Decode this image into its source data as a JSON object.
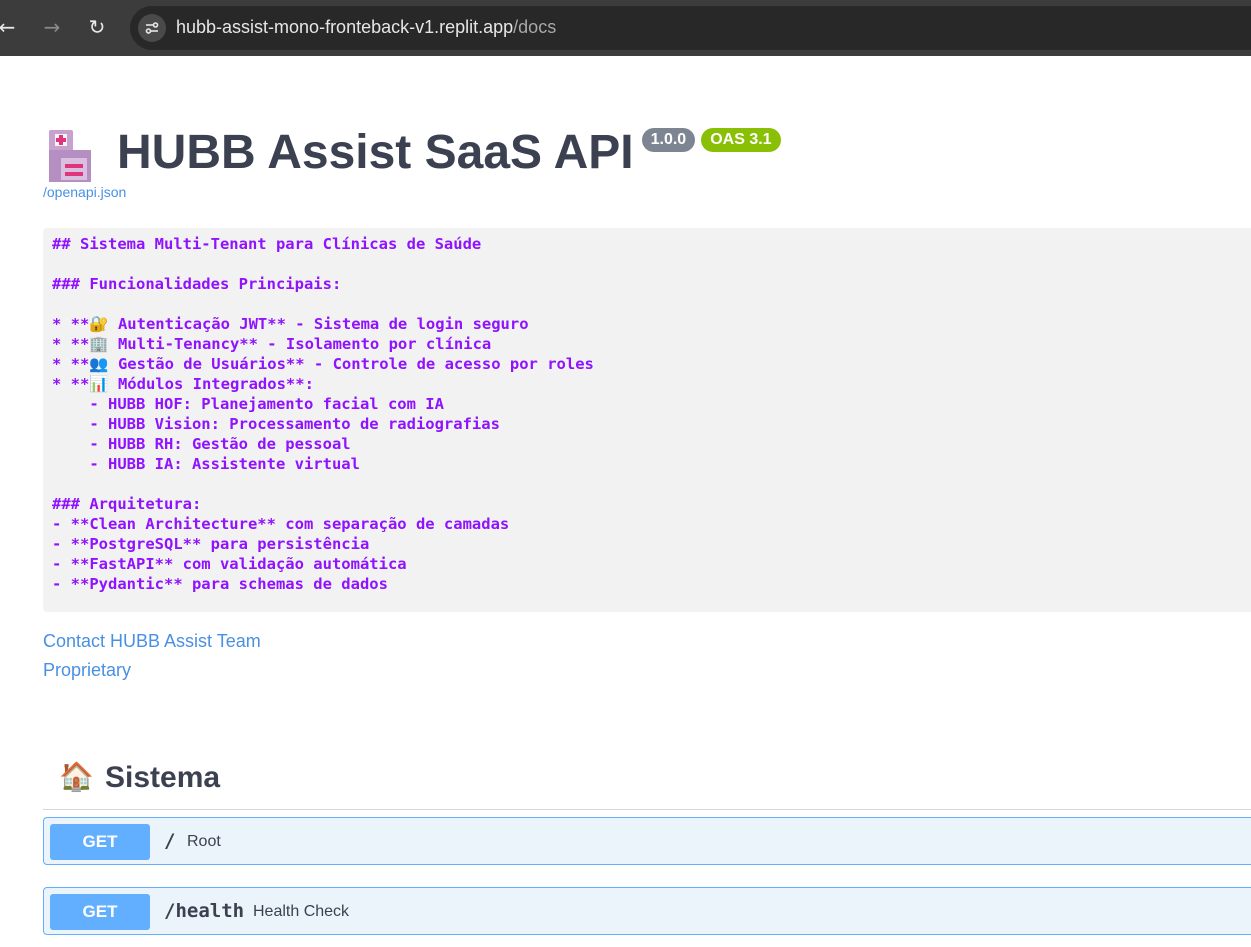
{
  "browser": {
    "url_host": "hubb-assist-mono-fronteback-v1.replit.app",
    "url_path": "/docs",
    "back_glyph": "←",
    "forward_glyph": "→",
    "reload_glyph": "↻"
  },
  "info": {
    "title": "HUBB Assist SaaS API",
    "version": "1.0.0",
    "oas": "OAS 3.1",
    "spec_url": "/openapi.json",
    "description_lines": [
      "## Sistema Multi-Tenant para Clínicas de Saúde",
      "",
      "### Funcionalidades Principais:",
      "",
      "* **🔐 Autenticação JWT** - Sistema de login seguro",
      "* **🏢 Multi-Tenancy** - Isolamento por clínica",
      "* **👥 Gestão de Usuários** - Controle de acesso por roles",
      "* **📊 Módulos Integrados**:",
      "    - HUBB HOF: Planejamento facial com IA",
      "    - HUBB Vision: Processamento de radiografias",
      "    - HUBB RH: Gestão de pessoal",
      "    - HUBB IA: Assistente virtual",
      "",
      "### Arquitetura:",
      "- **Clean Architecture** com separação de camadas",
      "- **PostgreSQL** para persistência",
      "- **FastAPI** com validação automática",
      "- **Pydantic** para schemas de dados"
    ],
    "contact_label": "Contact HUBB Assist Team",
    "license_label": "Proprietary"
  },
  "section": {
    "icon": "🏠",
    "title": "Sistema"
  },
  "operations": [
    {
      "method": "GET",
      "path": "/",
      "summary": "Root"
    },
    {
      "method": "GET",
      "path": "/health",
      "summary": "Health Check"
    }
  ],
  "colors": {
    "get_method": "#61affe",
    "get_bg": "#ebf3fb",
    "description_text": "#9012fe",
    "link": "#4990e2",
    "oas_badge": "#89bf04",
    "version_badge": "#7d8492"
  },
  "icons": {
    "logo": "hospital-icon",
    "site_info": "tune-icon"
  }
}
